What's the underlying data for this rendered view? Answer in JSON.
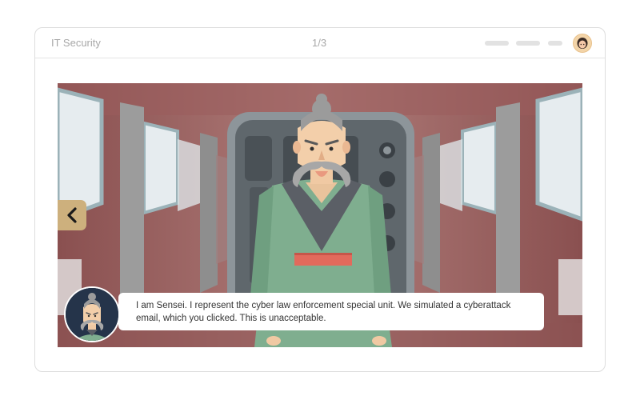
{
  "header": {
    "course_title": "IT Security",
    "page_counter": "1/3"
  },
  "navigation": {
    "prev_icon": "chevron-left-icon"
  },
  "dialogue": {
    "speaker": "Sensei",
    "text": "I am Sensei. I represent the cyber law enforcement special unit. We simulated a cyberattack email, which you clicked. This is unacceptable."
  },
  "colors": {
    "accent_gold": "#cdb07d",
    "robe_green": "#7fae8f",
    "belt_red": "#e26a5c",
    "portrait_bg": "#25344a",
    "corridor_red": "#8c5353"
  }
}
